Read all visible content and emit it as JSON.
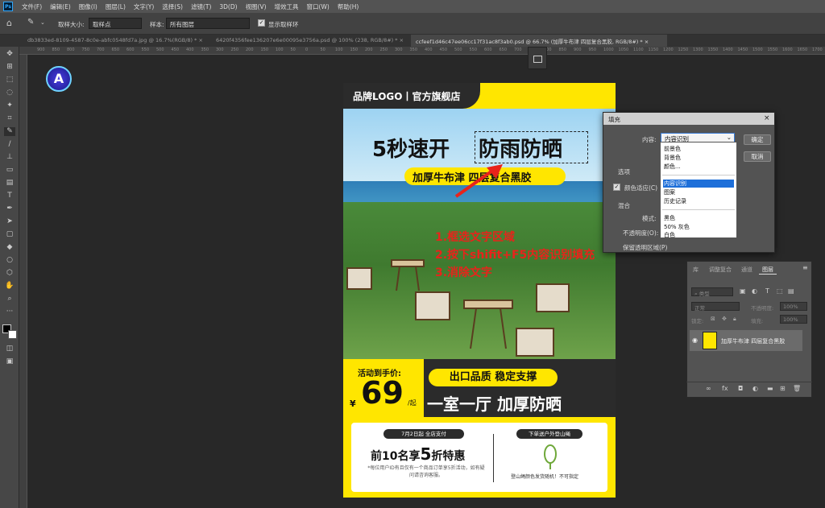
{
  "app": {
    "logo": "Ps"
  },
  "menu": [
    "文件(F)",
    "编辑(E)",
    "图像(I)",
    "图层(L)",
    "文字(Y)",
    "选择(S)",
    "滤镜(T)",
    "3D(D)",
    "视图(V)",
    "增效工具",
    "窗口(W)",
    "帮助(H)"
  ],
  "options": {
    "sample_size_label": "取样大小:",
    "sample_size_value": "取样点",
    "sample_label": "样本:",
    "sample_value": "所有图层",
    "show_ring_label": "显示取样环"
  },
  "tabs": [
    "db3833ed-8109-4587-8c0e-abfc0548fd7a.jpg @ 16.7%(RGB/8) *",
    "6420f4356fee136207e6e00095e3756a.psd @ 100% (238, RGB/8#) *",
    "ccfeef1d46c47ee06cc17f31ac8f3ab0.psd @ 66.7% (加厚牛布津 四层复合黑胶, RGB/8#) *"
  ],
  "ruler_ticks": [
    "900",
    "850",
    "800",
    "750",
    "700",
    "650",
    "600",
    "550",
    "500",
    "450",
    "400",
    "350",
    "300",
    "250",
    "200",
    "150",
    "100",
    "50",
    "0",
    "50",
    "100",
    "150",
    "200",
    "250",
    "300",
    "350",
    "400",
    "450",
    "500",
    "550",
    "600",
    "650",
    "700",
    "750",
    "800",
    "850",
    "900",
    "950",
    "1000",
    "1050",
    "1100",
    "1150",
    "1200",
    "1250",
    "1300",
    "1350",
    "1400",
    "1450",
    "1500",
    "1550",
    "1600",
    "1650",
    "1700"
  ],
  "poster": {
    "brand": "品牌LOGO丨官方旗舰店",
    "title_left": "5秒速开",
    "title_right": "防雨防晒",
    "subtitle": "加厚牛布津 四层复合黑胶",
    "price_label": "活动到手价:",
    "price_symbol": "¥",
    "price_value": "69",
    "price_unit": "/起",
    "quality_tag": "出口品质 稳定支撑",
    "slogan": "一室一厅 加厚防晒",
    "promo_pill": "7月2日起 全店支付",
    "promo_main_a": "前10名享",
    "promo_main_b": "5",
    "promo_main_c": "折特惠",
    "promo_note": "*每位用户ID有且仅有一个商品订单享5折活动，如有疑问请咨询客服。",
    "gift_pill": "下单送户外登山绳",
    "rope_note": "登山绳颜色发货随机！不可指定"
  },
  "steps": [
    "1.框选文字区域",
    "2.按下shifit+F5内容识别填充",
    "3.消除文字"
  ],
  "dialog": {
    "title": "填充",
    "content_label": "内容:",
    "content_value": "内容识别",
    "ok": "确定",
    "cancel": "取消",
    "options_label": "选项",
    "color_adapt_label": "颜色适应(C)",
    "blend_label": "混合",
    "mode_label": "模式:",
    "opacity_label": "不透明度(O):",
    "preserve_label": "保留透明区域(P)",
    "dropdown": [
      "前景色",
      "背景色",
      "颜色...",
      "内容识别",
      "图案",
      "历史记录",
      "黑色",
      "50% 灰色",
      "白色"
    ]
  },
  "layers_panel": {
    "tabs": [
      "库",
      "调整复合",
      "通道",
      "图层"
    ],
    "filter_label": "类型",
    "blend_mode": "正常",
    "opacity_label": "不透明度:",
    "opacity_value": "100%",
    "lock_label": "锁定:",
    "fill_label": "填充:",
    "fill_value": "100%",
    "layer_name": "加厚牛布津 四层复合黑胶"
  },
  "colors": {
    "accent_yellow": "#ffe600",
    "annotation_red": "#e8231b",
    "dark": "#2b2b2b"
  }
}
